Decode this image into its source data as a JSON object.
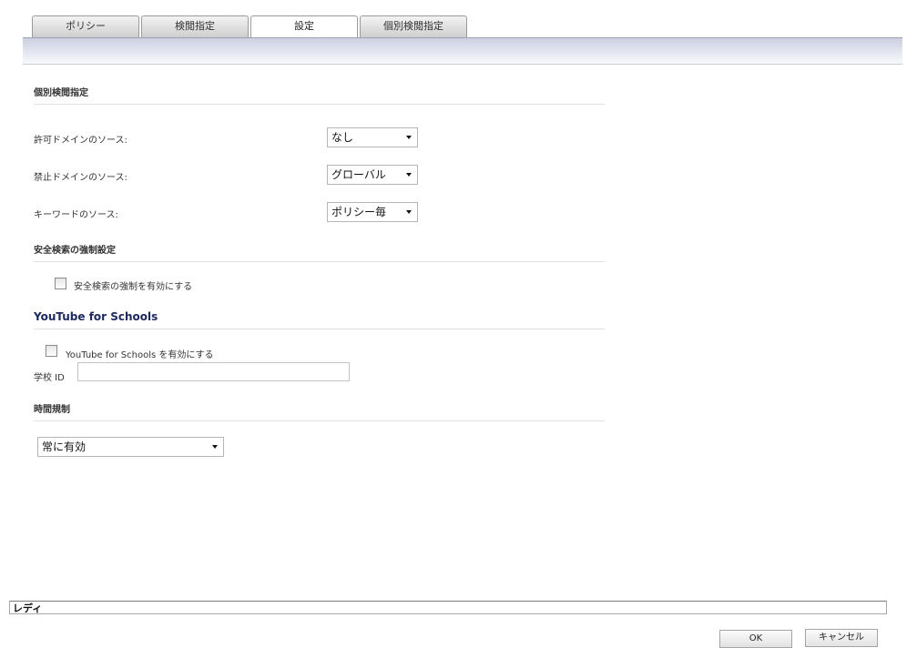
{
  "tabs": [
    {
      "label": "ポリシー"
    },
    {
      "label": "検閲指定"
    },
    {
      "label": "設定"
    },
    {
      "label": "個別検閲指定"
    }
  ],
  "section_custom": {
    "title": "個別検閲指定",
    "allowed_label": "許可ドメインのソース:",
    "allowed_value": "なし",
    "forbidden_label": "禁止ドメインのソース:",
    "forbidden_value": "グローバル",
    "keyword_label": "キーワードのソース:",
    "keyword_value": "ポリシー毎"
  },
  "section_safesearch": {
    "title": "安全検索の強制設定",
    "checkbox_label": "安全検索の強制を有効にする",
    "checked": false
  },
  "section_youtube": {
    "title": "YouTube for Schools",
    "checkbox_label": "YouTube for Schools を有効にする",
    "checked": false,
    "school_id_label": "学校 ID",
    "school_id_value": ""
  },
  "section_time": {
    "title": "時間規制",
    "value": "常に有効"
  },
  "status": {
    "text": "レディ"
  },
  "buttons": {
    "ok": "OK",
    "cancel": "キャンセル"
  }
}
